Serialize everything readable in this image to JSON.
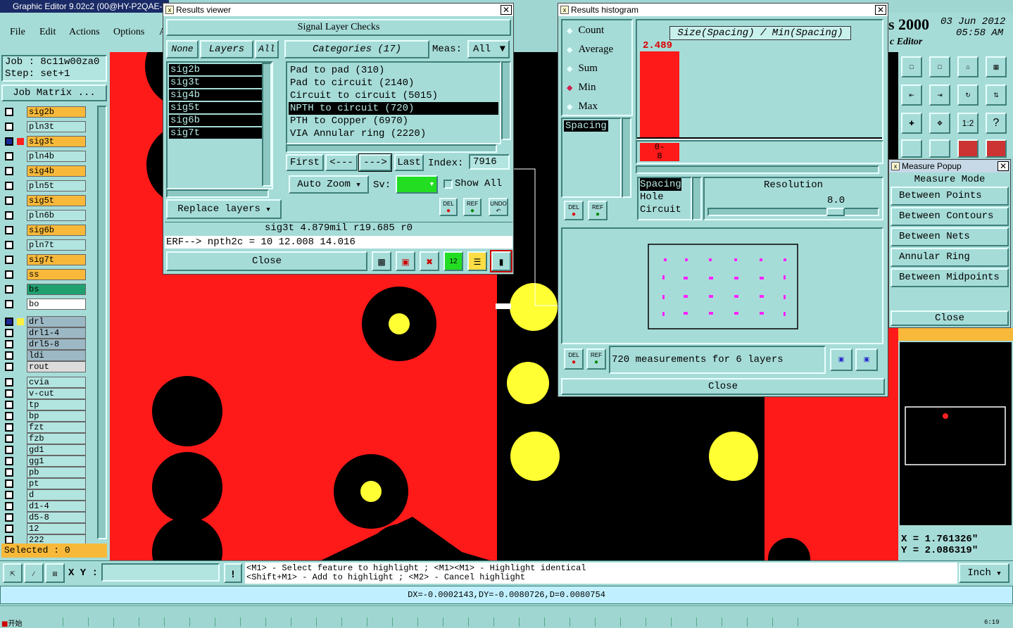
{
  "app": {
    "title": "Graphic Editor 9.02c2 (00@HY-P2QAE-",
    "brand": "s 2000",
    "date": "03 Jun 2012",
    "time": "05:58 AM",
    "subtitle": "c Editor"
  },
  "menu": [
    "File",
    "Edit",
    "Actions",
    "Options",
    "A"
  ],
  "job": {
    "job": "Job : 8c11w00za0",
    "step": "Step: set+1",
    "matrix": "Job Matrix ..."
  },
  "layers": [
    {
      "name": "sig2b",
      "color": "#f8b93a",
      "on": false
    },
    {
      "name": "pln3t",
      "color": "#b2e4e0",
      "on": false
    },
    {
      "name": "sig3t",
      "color": "#f8b93a",
      "on": true,
      "swatch": "#ff2020"
    },
    {
      "name": "pln4b",
      "color": "#b2e4e0",
      "on": false
    },
    {
      "name": "sig4b",
      "color": "#f8b93a",
      "on": false
    },
    {
      "name": "pln5t",
      "color": "#b2e4e0",
      "on": false
    },
    {
      "name": "sig5t",
      "color": "#f8b93a",
      "on": false
    },
    {
      "name": "pln6b",
      "color": "#b2e4e0",
      "on": false
    },
    {
      "name": "sig6b",
      "color": "#f8b93a",
      "on": false
    },
    {
      "name": "pln7t",
      "color": "#b2e4e0",
      "on": false
    },
    {
      "name": "sig7t",
      "color": "#f8b93a",
      "on": false
    },
    {
      "name": "ss",
      "color": "#f8b93a",
      "on": false
    },
    {
      "name": "bs",
      "color": "#20a070",
      "on": false
    },
    {
      "name": "bo",
      "color": "#ffffff",
      "on": false
    }
  ],
  "drill_layers": [
    {
      "name": "drl",
      "color": "#9cb8c4",
      "on": true,
      "swatch": "#ffee40"
    },
    {
      "name": "drl1-4",
      "color": "#9cb8c4"
    },
    {
      "name": "drl5-8",
      "color": "#9cb8c4"
    },
    {
      "name": "ldi",
      "color": "#9cb8c4"
    },
    {
      "name": "rout",
      "color": "#dcdcdc"
    }
  ],
  "misc_layers": [
    "cvia",
    "v-cut",
    "tp",
    "bp",
    "fzt",
    "fzb",
    "gd1",
    "gg1",
    "pb",
    "pt",
    "d",
    "d1-4",
    "d5-8",
    "12",
    "222"
  ],
  "selected": "Selected : 0",
  "results_viewer": {
    "title": "Results viewer",
    "heading": "Signal Layer Checks",
    "none": "None",
    "layers_label": "Layers",
    "all": "All",
    "categories": "Categories (17)",
    "meas_label": "Meas:",
    "meas_value": "All",
    "layers": [
      "sig2b",
      "sig3t",
      "sig4b",
      "sig5t",
      "sig6b",
      "sig7t"
    ],
    "items": [
      "Pad to pad (310)",
      "Pad to circuit (2140)",
      "Circuit to circuit (5015)",
      "NPTH to circuit (720)",
      "PTH to Copper (6970)",
      "VIA Annular ring (2220)"
    ],
    "selected_item": 3,
    "first": "First",
    "prev": "<---",
    "next": "--->",
    "last": "Last",
    "index_label": "Index:",
    "index_value": "7916",
    "auto_zoom": "Auto Zoom",
    "sv_label": "Sv:",
    "show_all": "Show All",
    "replace_layers": "Replace layers",
    "del": "DEL",
    "ref": "REF",
    "undo": "UNDO",
    "status1": "sig3t 4.879mil  r19.685  r0",
    "status2": "ERF--> npth2c = 10 12.008 14.016",
    "close": "Close"
  },
  "histogram": {
    "title": "Results histogram",
    "options": [
      "Count",
      "Average",
      "Sum",
      "Min",
      "Max"
    ],
    "selected_option": 3,
    "chart_title": "Size(Spacing) / Min(Spacing)",
    "bar_value": "2.489",
    "bin_label": "0-8",
    "list1": [
      "Spacing"
    ],
    "list2": [
      "Spacing",
      "Hole",
      "Circuit"
    ],
    "resolution_label": "Resolution",
    "resolution_value": "8.0",
    "resolution_fraction": 0.78,
    "measurements": "720 measurements for 6 layers",
    "del": "DEL",
    "ref": "REF",
    "close": "Close"
  },
  "measure_popup": {
    "title": "Measure Popup",
    "heading": "Measure Mode",
    "items": [
      "Between Points",
      "Between Contours",
      "Between Nets",
      "Annular Ring",
      "Between Midpoints"
    ],
    "close": "Close"
  },
  "toolbar_icons": [
    "1:2",
    "?"
  ],
  "coords": {
    "x": "X = 1.761326\"",
    "y": "Y = 2.086319\""
  },
  "bottom": {
    "xy_label": "X Y :",
    "hint1": "<M1> - Select feature to highlight ; <M1><M1> - Highlight identical",
    "hint2": "<Shift+M1> - Add to highlight ; <M2> - Cancel highlight",
    "units": "Inch",
    "delta": "DX=-0.0002143,DY=-0.0080726,D=0.0080754"
  },
  "taskbar": {
    "start": "开始",
    "clock": "6:19"
  },
  "colors": {
    "copper": "#ff1a1a",
    "drill": "#ffff33",
    "bg": "#000000",
    "panel": "#a6dcd8",
    "layer_signal": "#f8b93a"
  }
}
